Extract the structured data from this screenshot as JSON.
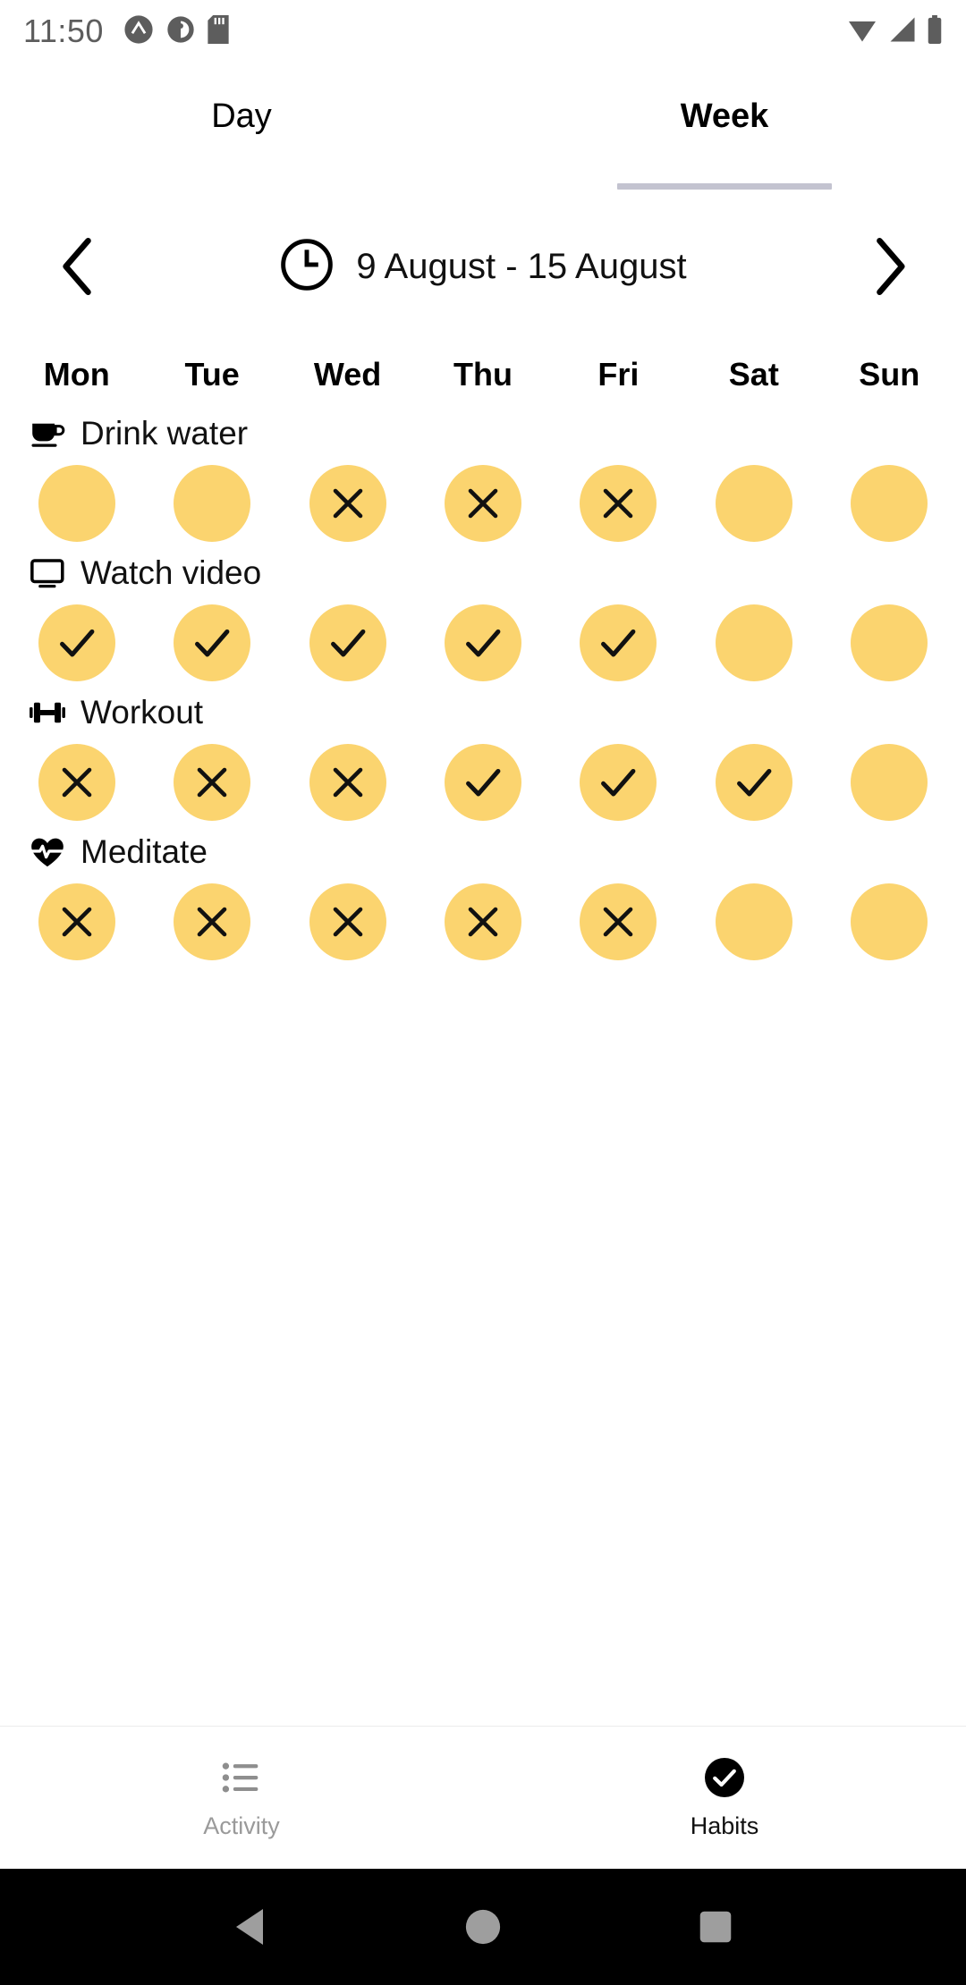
{
  "status_bar": {
    "time": "11:50",
    "left_icons": [
      "app-notification-icon",
      "app-notification-icon-2",
      "sd-card-icon"
    ],
    "right_icons": [
      "wifi-icon",
      "cellular-signal-icon",
      "battery-icon"
    ],
    "icon_color": "#5d5d5d"
  },
  "tabs": [
    {
      "label": "Day",
      "active": false
    },
    {
      "label": "Week",
      "active": true
    }
  ],
  "tab_indicator_color": "#c3c3d0",
  "date_nav": {
    "prev_label": "‹",
    "next_label": "›",
    "clock_icon": "clock-icon",
    "range": "9 August - 15 August"
  },
  "weekdays": [
    "Mon",
    "Tue",
    "Wed",
    "Thu",
    "Fri",
    "Sat",
    "Sun"
  ],
  "circle_color": "#fbd46f",
  "habits": [
    {
      "name": "Drink water",
      "icon": "coffee-cup-icon",
      "states": [
        "none",
        "none",
        "cross",
        "cross",
        "cross",
        "none",
        "none"
      ]
    },
    {
      "name": "Watch video",
      "icon": "monitor-icon",
      "states": [
        "check",
        "check",
        "check",
        "check",
        "check",
        "none",
        "none"
      ]
    },
    {
      "name": "Workout",
      "icon": "dumbbell-icon",
      "states": [
        "cross",
        "cross",
        "cross",
        "check",
        "check",
        "check",
        "none"
      ]
    },
    {
      "name": "Meditate",
      "icon": "heart-pulse-icon",
      "states": [
        "cross",
        "cross",
        "cross",
        "cross",
        "cross",
        "none",
        "none"
      ]
    }
  ],
  "bottom_nav": [
    {
      "label": "Activity",
      "icon": "list-icon",
      "active": false
    },
    {
      "label": "Habits",
      "icon": "check-circle-icon",
      "active": true
    }
  ],
  "system_nav": {
    "back": "back-triangle-icon",
    "home": "home-circle-icon",
    "recents": "recents-square-icon",
    "icon_color": "#9e9e9e"
  }
}
